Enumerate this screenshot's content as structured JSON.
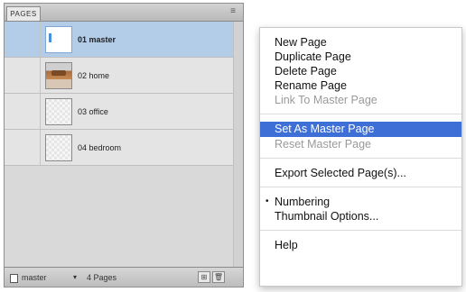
{
  "panel": {
    "tab_label": "PAGES",
    "menu_glyph": "≡",
    "pages": [
      {
        "label": "01 master",
        "thumb": "master",
        "selected": true
      },
      {
        "label": "02 home",
        "thumb": "home",
        "selected": false
      },
      {
        "label": "03 office",
        "thumb": "blank",
        "selected": false
      },
      {
        "label": "04 bedroom",
        "thumb": "blank",
        "selected": false
      }
    ],
    "footer": {
      "master_name": "master",
      "dropdown_glyph": "▾",
      "page_count": "4 Pages",
      "new_page_glyph": "⊞",
      "delete_glyph": "🗑"
    }
  },
  "menu": {
    "items": [
      {
        "label": "New Page",
        "state": "normal"
      },
      {
        "label": "Duplicate Page",
        "state": "normal"
      },
      {
        "label": "Delete Page",
        "state": "normal"
      },
      {
        "label": "Rename Page",
        "state": "normal"
      },
      {
        "label": "Link To Master Page",
        "state": "disabled"
      },
      {
        "label": "Set As Master Page",
        "state": "highlighted"
      },
      {
        "label": "Reset Master Page",
        "state": "disabled"
      },
      {
        "label": "Export Selected Page(s)...",
        "state": "normal"
      },
      {
        "label": "Numbering",
        "state": "checked"
      },
      {
        "label": "Thumbnail Options...",
        "state": "normal"
      },
      {
        "label": "Help",
        "state": "normal"
      }
    ],
    "check_glyph": "•"
  },
  "colors": {
    "selection": "#b3cde8",
    "menu_highlight": "#3d6fd6"
  }
}
